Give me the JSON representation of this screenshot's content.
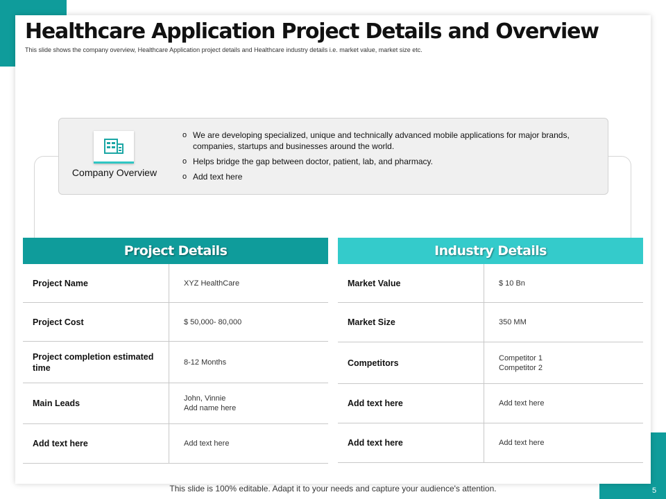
{
  "slide": {
    "title": "Healthcare Application Project Details and Overview",
    "subtitle": "This slide shows the company overview, Healthcare Application project details and Healthcare industry details i.e. market value, market size etc.",
    "footer": "This slide is 100% editable. Adapt it to your needs and capture your audience's attention.",
    "page_number": "5",
    "colors": {
      "accent_dark": "#0f9c9b",
      "accent_light": "#34cbcb"
    }
  },
  "overview": {
    "icon": "company-building-icon",
    "label": "Company Overview",
    "bullets": [
      "We are developing  specialized, unique and technically advanced  mobile applications for major brands, companies, startups and businesses around the world.",
      "Helps bridge the gap between doctor, patient, lab, and pharmacy.",
      "Add text here"
    ]
  },
  "project_details": {
    "header": "Project Details",
    "rows": [
      {
        "label": "Project Name",
        "value": [
          "XYZ  HealthCare"
        ]
      },
      {
        "label": "Project Cost",
        "value": [
          "$ 50,000- 80,000"
        ]
      },
      {
        "label": "Project completion estimated time",
        "value": [
          "8-12 Months"
        ]
      },
      {
        "label": "Main Leads",
        "value": [
          "John, Vinnie",
          "Add name here"
        ]
      },
      {
        "label": "Add text here",
        "value": [
          "Add text here"
        ]
      }
    ]
  },
  "industry_details": {
    "header": "Industry Details",
    "rows": [
      {
        "label": "Market Value",
        "value": [
          "$ 10 Bn"
        ]
      },
      {
        "label": "Market Size",
        "value": [
          "350 MM"
        ]
      },
      {
        "label": "Competitors",
        "value": [
          "Competitor 1",
          "Competitor 2"
        ]
      },
      {
        "label": "Add text here",
        "value": [
          "Add text here"
        ]
      },
      {
        "label": "Add text here",
        "value": [
          "Add text here"
        ]
      }
    ]
  }
}
